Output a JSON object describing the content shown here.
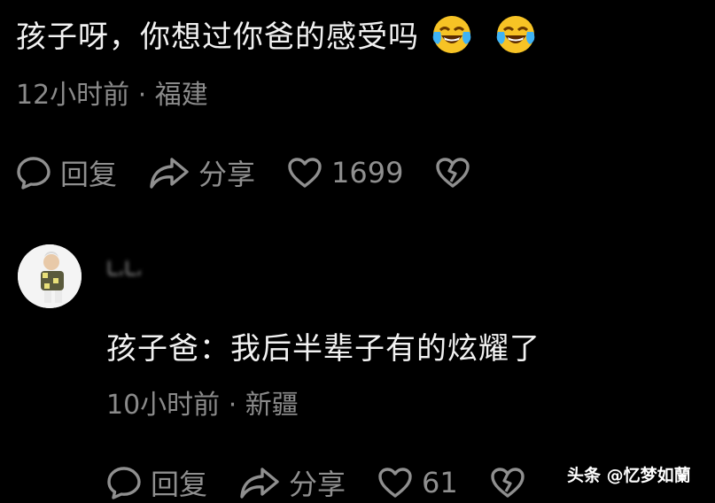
{
  "main_comment": {
    "text": "孩子呀，你想过你爸的感受吗",
    "emojis": [
      "laughing-crying-emoji",
      "laughing-crying-emoji"
    ],
    "time_location": "12小时前 · 福建",
    "actions": {
      "reply": "回复",
      "share": "分享",
      "like_count": "1699"
    }
  },
  "reply_comment": {
    "username": "ـا،ـا،",
    "text": "孩子爸：我后半辈子有的炫耀了",
    "time_location": "10小时前 · 新疆",
    "actions": {
      "reply": "回复",
      "share": "分享",
      "like_count": "61"
    }
  },
  "watermark": "头条 @忆梦如蘭",
  "colors": {
    "background": "#000000",
    "text": "#f2f2f2",
    "muted": "#8a8a8a"
  }
}
